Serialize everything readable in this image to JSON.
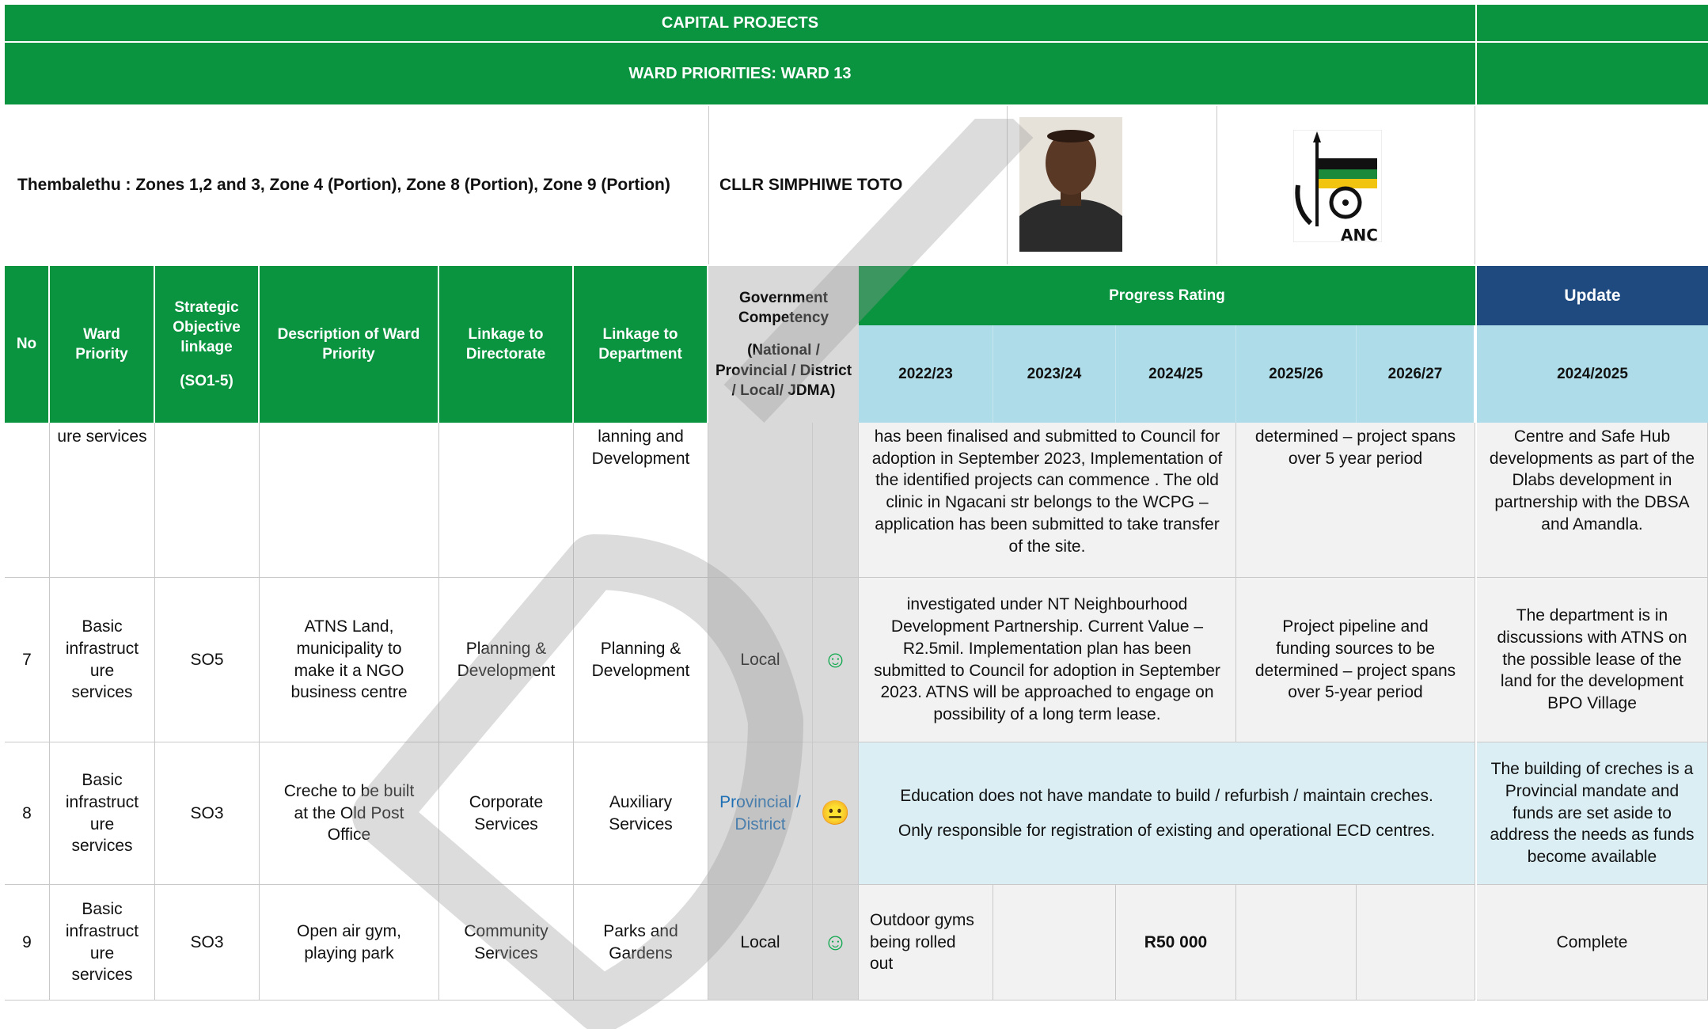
{
  "titles": {
    "main": "CAPITAL PROJECTS",
    "sub": "WARD PRIORITIES: WARD 13"
  },
  "ward_info": {
    "area": "Thembalethu : Zones 1,2  and 3,  Zone 4 (Portion), Zone 8 (Portion), Zone 9 (Portion)",
    "councillor": "CLLR SIMPHIWE TOTO",
    "party_logo_text": "ANC"
  },
  "headers": {
    "no": "No",
    "ward_priority": "Ward Priority",
    "strategic_1": "Strategic Objective linkage",
    "strategic_2": "(SO1-5)",
    "description": "Description of Ward Priority",
    "directorate": "Linkage to Directorate",
    "department": "Linkage to Department",
    "gov_1": "Government Competency",
    "gov_2": "(National / Provincial / District / Local/ JDMA)",
    "progress": "Progress Rating",
    "update": "Update",
    "y2223": "2022/23",
    "y2324": "2023/24",
    "y2425": "2024/25",
    "y2526": "2025/26",
    "y2627": "2026/27",
    "update_year": "2024/2025"
  },
  "rows": {
    "r6": {
      "priority": "ure services",
      "department": "lanning and Development",
      "progress": "has been finalised and submitted to Council for adoption in September 2023, Implementation of the identified projects can commence .  The old clinic in Ngacani str belongs to the WCPG – application has been submitted to take transfer of the site.",
      "future": "determined – project spans over 5 year period",
      "update": "Centre and Safe Hub developments as part of the Dlabs development in partnership with the DBSA and Amandla."
    },
    "r7": {
      "no": "7",
      "priority": "Basic infrastruct ure services",
      "so": "SO5",
      "description": "ATNS Land, municipality to make it a NGO business centre",
      "directorate": "Planning & Development",
      "department": "Planning & Development",
      "competency": "Local",
      "rating_icon": "smiley-icon",
      "progress": "investigated under NT Neighbourhood Development Partnership.  Current Value – R2.5mil.  Implementation plan has been submitted to Council for adoption in September 2023.  ATNS will be approached to engage on possibility of a long term lease.",
      "future": "Project pipeline and funding sources to be determined – project spans over 5-year period",
      "update": "The department is in discussions with ATNS on the possible lease of the land for the development BPO Village"
    },
    "r8": {
      "no": "8",
      "priority": "Basic infrastruct ure services",
      "so": "SO3",
      "description": "Creche to be built at the Old Post Office",
      "directorate": "Corporate Services",
      "department": "Auxiliary Services",
      "competency": "Provincial / District",
      "rating_icon": "neutral-face-icon",
      "progress_1": "Education does not have mandate to build / refurbish / maintain creches.",
      "progress_2": "Only responsible for registration of existing and operational ECD centres.",
      "update": "The building of creches is a Provincial mandate and funds are set aside to address the needs as funds become available"
    },
    "r9": {
      "no": "9",
      "priority": "Basic infrastruct ure services",
      "so": "SO3",
      "description": "Open air gym, playing park",
      "directorate": "Community Services",
      "department": "Parks and Gardens",
      "competency": "Local",
      "rating_icon": "smiley-icon",
      "y2223": "Outdoor gyms being rolled out",
      "y2425": "R50 000",
      "update": "Complete"
    }
  },
  "colors": {
    "header_green": "#0a9440",
    "update_blue": "#1f4a7f",
    "year_band": "#aedde9",
    "competency_grey": "#d9d9d9",
    "smiley_green": "#10a84e",
    "neutral_blue": "#3d85c6"
  }
}
